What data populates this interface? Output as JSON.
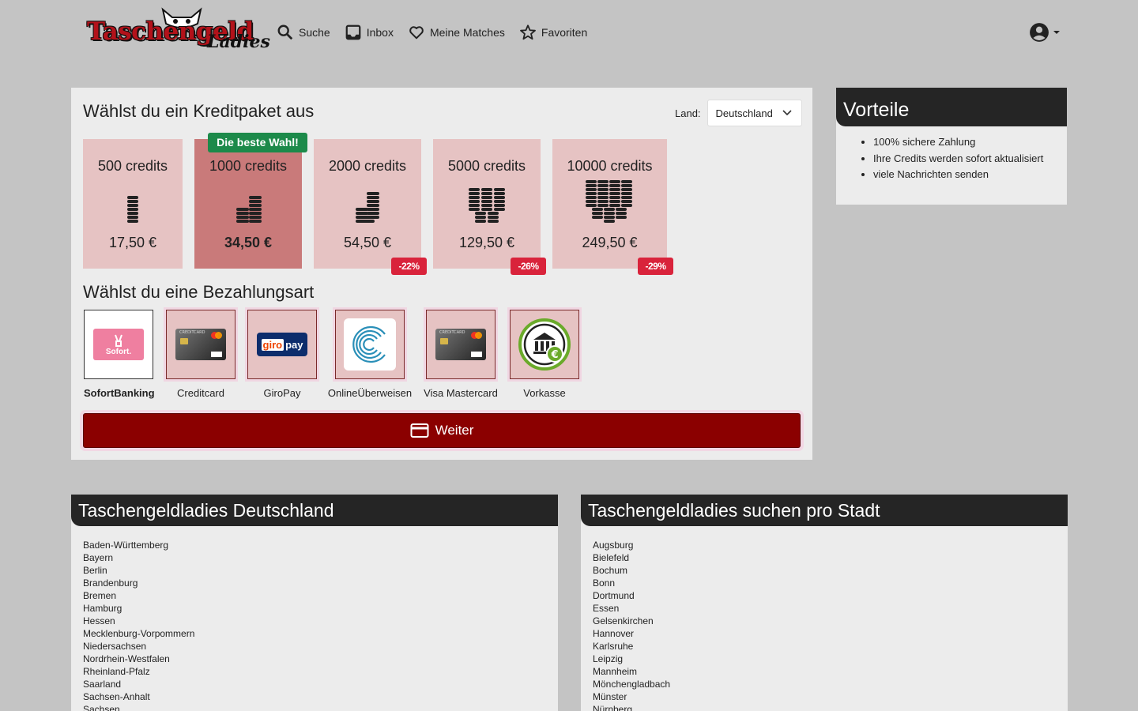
{
  "header": {
    "logo_word1": "Taschengeld",
    "logo_word2": "Ladies",
    "nav": [
      {
        "label": "Suche",
        "icon": "search-icon"
      },
      {
        "label": "Inbox",
        "icon": "inbox-icon"
      },
      {
        "label": "Meine Matches",
        "icon": "heart-icon"
      },
      {
        "label": "Favoriten",
        "icon": "star-icon"
      }
    ],
    "account_icon": "account-circle-icon"
  },
  "credit_section": {
    "title": "Wählst du ein Kreditpaket aus",
    "land_label": "Land:",
    "land_value": "Deutschland",
    "best_badge": "Die beste Wahl!",
    "packages": [
      {
        "title": "500 credits",
        "price": "17,50 €",
        "discount": ""
      },
      {
        "title": "1000 credits",
        "price": "34,50 €",
        "discount": "",
        "best": true
      },
      {
        "title": "2000 credits",
        "price": "54,50 €",
        "discount": "-22%"
      },
      {
        "title": "5000 credits",
        "price": "129,50 €",
        "discount": "-26%"
      },
      {
        "title": "10000 credits",
        "price": "249,50 €",
        "discount": "-29%"
      }
    ]
  },
  "payment_section": {
    "title": "Wählst du eine Bezahlungsart",
    "methods": [
      {
        "label": "SofortBanking",
        "logo_text": "Sofort.",
        "selected": true
      },
      {
        "label": "Creditcard",
        "logo_text": "CREDITCARD"
      },
      {
        "label": "GiroPay",
        "logo_text_a": "giro",
        "logo_text_b": "pay"
      },
      {
        "label": "OnlineÜberweisen"
      },
      {
        "label": "Visa Mastercard",
        "logo_text": "CREDITCARD"
      },
      {
        "label": "Vorkasse"
      }
    ],
    "continue_label": "Weiter"
  },
  "vorteile": {
    "title": "Vorteile",
    "items": [
      "100% sichere Zahlung",
      "Ihre Credits werden sofort aktualisiert",
      "viele Nachrichten senden"
    ]
  },
  "states_panel": {
    "title": "Taschengeldladies Deutschland",
    "items": [
      "Baden-Württemberg",
      "Bayern",
      "Berlin",
      "Brandenburg",
      "Bremen",
      "Hamburg",
      "Hessen",
      "Mecklenburg-Vorpommern",
      "Niedersachsen",
      "Nordrhein-Westfalen",
      "Rheinland-Pfalz",
      "Saarland",
      "Sachsen-Anhalt",
      "Sachsen"
    ]
  },
  "cities_panel": {
    "title": "Taschengeldladies suchen pro Stadt",
    "items": [
      "Augsburg",
      "Bielefeld",
      "Bochum",
      "Bonn",
      "Dortmund",
      "Essen",
      "Gelsenkirchen",
      "Hannover",
      "Karlsruhe",
      "Leipzig",
      "Mannheim",
      "Mönchengladbach",
      "Münster",
      "Nürnberg"
    ]
  },
  "colors": {
    "page_bg": "#c4c4c4",
    "panel_bg": "#ececec",
    "package_bg": "#e6c3c3",
    "package_best_bg": "#c97a7a",
    "badge_green": "#1c8a4a",
    "discount_red": "#d9233b",
    "button_dark_red": "#8b0000",
    "panel_head": "#252525"
  }
}
